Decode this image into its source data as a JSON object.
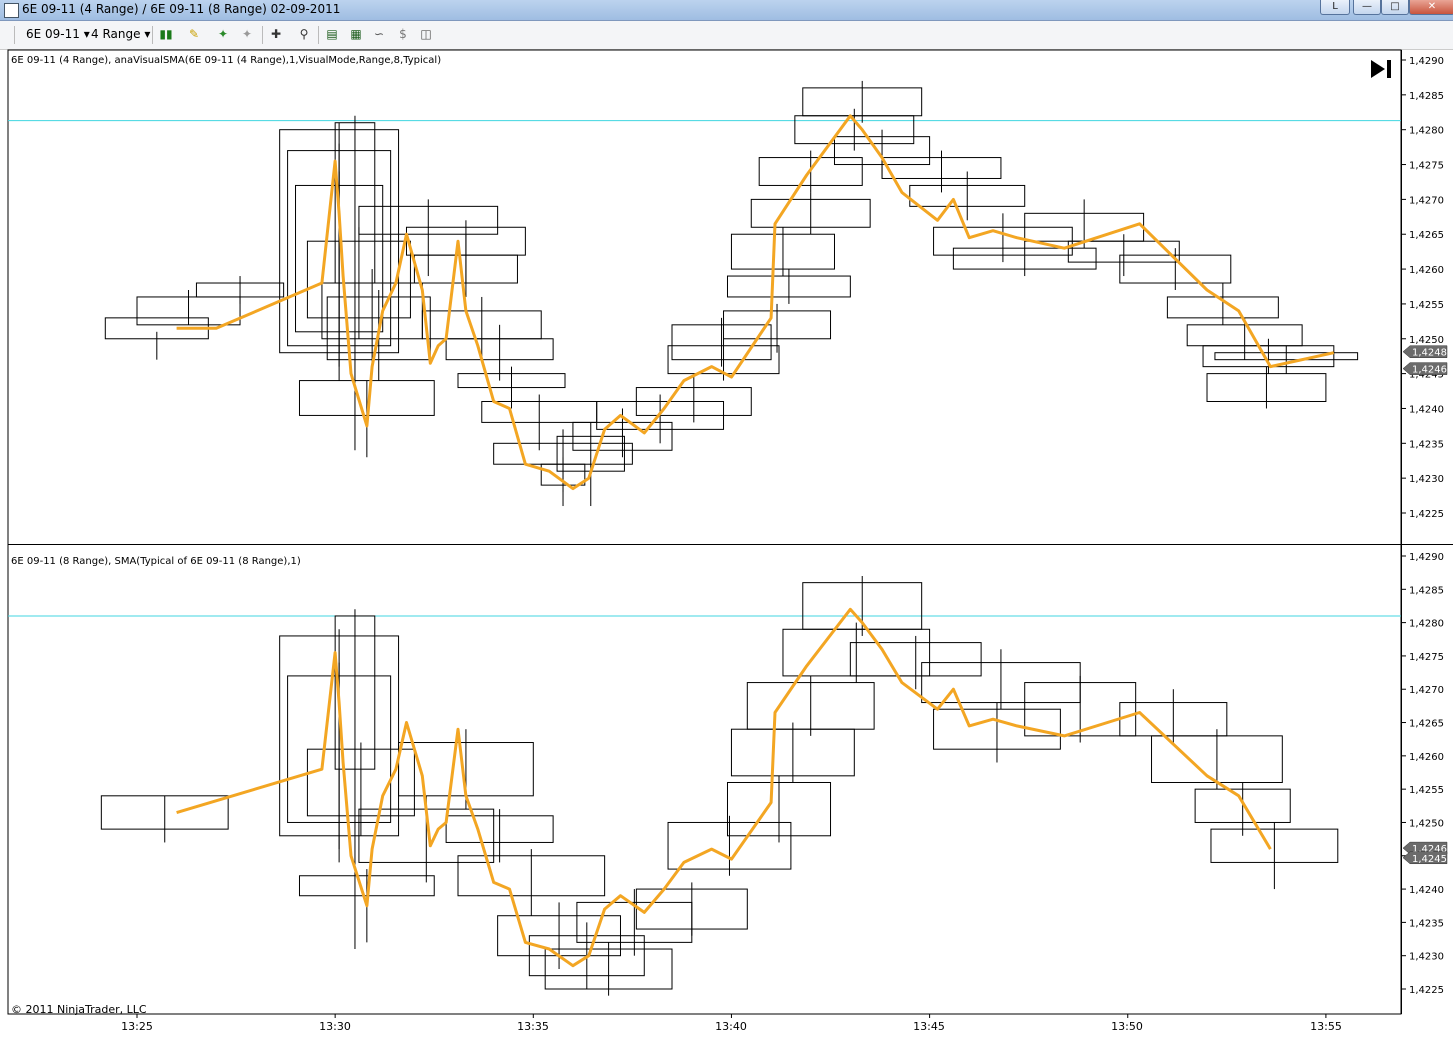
{
  "window": {
    "title": "6E 09-11 (4 Range) / 6E 09-11 (8 Range)  02-09-2011",
    "buttons": [
      "L",
      "—",
      "□",
      "✕"
    ]
  },
  "toolbar": {
    "instrument": "6E 09-11",
    "interval": "4 Range",
    "icons": [
      "bar-style-icon",
      "drawing-pencil-icon",
      "pin-icon",
      "pin-gray-icon",
      "crosshair-icon",
      "zoom-icon",
      "chart-properties-icon",
      "indicators-icon",
      "strategies-icon",
      "dollar-icon",
      "window-icon"
    ]
  },
  "colors": {
    "sma": "#f3a623",
    "hline": "#41d6e0",
    "bars": "#000000"
  },
  "copyright": "© 2011 NinjaTrader, LLC",
  "chart_data": [
    {
      "type": "candlestick",
      "title": "6E 09-11 (4 Range), anaVisualSMA(6E 09-11 (4 Range),1,VisualMode,Range,8,Typical)",
      "xlabel": "",
      "ylabel": "",
      "ylim": [
        1.4222,
        1.4292
      ],
      "yticks": [
        "1,4290",
        "1,4285",
        "1,4280",
        "1,4275",
        "1,4270",
        "1,4265",
        "1,4260",
        "1,4255",
        "1,4250",
        "1,4245",
        "1,4240",
        "1,4235",
        "1,4230",
        "1,4225"
      ],
      "hline": 1.42813,
      "price_markers": [
        "1,4248",
        "1,4246"
      ],
      "sma": {
        "x": [
          "13:26:00",
          "13:27:00",
          "13:29:40",
          "13:30:00",
          "13:30:06",
          "13:30:12",
          "13:30:24",
          "13:30:48",
          "13:30:56",
          "13:31:12",
          "13:31:32",
          "13:31:48",
          "13:32:12",
          "13:32:24",
          "13:32:36",
          "13:32:48",
          "13:33:06",
          "13:33:18",
          "13:33:36",
          "13:34:00",
          "13:34:24",
          "13:34:48",
          "13:35:24",
          "13:36:00",
          "13:36:24",
          "13:36:48",
          "13:37:12",
          "13:37:48",
          "13:38:18",
          "13:38:48",
          "13:39:30",
          "13:40:00",
          "13:41:00",
          "13:41:06",
          "13:41:54",
          "13:43:00",
          "13:43:18",
          "13:43:48",
          "13:44:18",
          "13:45:12",
          "13:45:36",
          "13:46:00",
          "13:46:36",
          "13:47:12",
          "13:48:24",
          "13:50:18",
          "13:52:00",
          "13:52:48",
          "13:53:36",
          "13:55:12"
        ],
        "y": [
          1.42515,
          1.42515,
          1.4258,
          1.42755,
          1.4268,
          1.4259,
          1.4245,
          1.42375,
          1.4246,
          1.4254,
          1.4258,
          1.4265,
          1.4257,
          1.42465,
          1.4249,
          1.425,
          1.4264,
          1.4254,
          1.4249,
          1.4241,
          1.424,
          1.4232,
          1.4231,
          1.42285,
          1.423,
          1.4237,
          1.4239,
          1.42365,
          1.424,
          1.4244,
          1.4246,
          1.42445,
          1.4253,
          1.42665,
          1.42735,
          1.4282,
          1.428,
          1.4276,
          1.4271,
          1.4267,
          1.427,
          1.42645,
          1.42655,
          1.42645,
          1.4263,
          1.42665,
          1.4257,
          1.4254,
          1.4246,
          1.4248
        ]
      },
      "bars": [
        {
          "x0": "13:24:12",
          "x1": "13:26:48",
          "o": 1.4253,
          "c": 1.425,
          "h": 1.4251,
          "l": 1.4247
        },
        {
          "x0": "13:25:00",
          "x1": "13:27:36",
          "o": 1.4256,
          "c": 1.4252,
          "h": 1.4257,
          "l": 1.4252
        },
        {
          "x0": "13:26:30",
          "x1": "13:28:42",
          "o": 1.4258,
          "c": 1.4256,
          "h": 1.4259,
          "l": 1.4255
        },
        {
          "x0": "13:28:36",
          "x1": "13:31:36",
          "o": 1.428,
          "c": 1.4248,
          "h": 1.4281,
          "l": 1.4244
        },
        {
          "x0": "13:28:48",
          "x1": "13:31:24",
          "o": 1.4277,
          "c": 1.4249,
          "h": 1.4278,
          "l": 1.4246
        },
        {
          "x0": "13:29:00",
          "x1": "13:31:12",
          "o": 1.4272,
          "c": 1.4251,
          "h": 1.4274,
          "l": 1.4248
        },
        {
          "x0": "13:29:18",
          "x1": "13:31:54",
          "o": 1.4264,
          "c": 1.4253,
          "h": 1.4266,
          "l": 1.425
        },
        {
          "x0": "13:29:40",
          "x1": "13:32:12",
          "o": 1.4258,
          "c": 1.425,
          "h": 1.426,
          "l": 1.4246
        },
        {
          "x0": "13:30:00",
          "x1": "13:31:00",
          "o": 1.4281,
          "c": 1.4258,
          "h": 1.4282,
          "l": 1.4234
        },
        {
          "x0": "13:29:48",
          "x1": "13:32:24",
          "o": 1.4256,
          "c": 1.4247,
          "h": 1.4257,
          "l": 1.4244
        },
        {
          "x0": "13:29:06",
          "x1": "13:32:30",
          "o": 1.4244,
          "c": 1.4239,
          "h": 1.4244,
          "l": 1.4233
        },
        {
          "x0": "13:30:36",
          "x1": "13:34:06",
          "o": 1.4269,
          "c": 1.4265,
          "h": 1.427,
          "l": 1.4259
        },
        {
          "x0": "13:31:48",
          "x1": "13:34:48",
          "o": 1.4266,
          "c": 1.4262,
          "h": 1.4267,
          "l": 1.4258
        },
        {
          "x0": "13:32:00",
          "x1": "13:34:36",
          "o": 1.4262,
          "c": 1.4258,
          "h": 1.4265,
          "l": 1.4256
        },
        {
          "x0": "13:32:12",
          "x1": "13:35:12",
          "o": 1.4254,
          "c": 1.425,
          "h": 1.4256,
          "l": 1.4247
        },
        {
          "x0": "13:32:48",
          "x1": "13:35:30",
          "o": 1.425,
          "c": 1.4247,
          "h": 1.4252,
          "l": 1.4244
        },
        {
          "x0": "13:33:06",
          "x1": "13:35:48",
          "o": 1.4245,
          "c": 1.4243,
          "h": 1.4246,
          "l": 1.424
        },
        {
          "x0": "13:33:42",
          "x1": "13:36:36",
          "o": 1.4241,
          "c": 1.4238,
          "h": 1.4242,
          "l": 1.4234
        },
        {
          "x0": "13:34:00",
          "x1": "13:37:30",
          "o": 1.4235,
          "c": 1.4232,
          "h": 1.4237,
          "l": 1.4228
        },
        {
          "x0": "13:35:12",
          "x1": "13:36:18",
          "o": 1.4232,
          "c": 1.4229,
          "h": 1.4233,
          "l": 1.4226
        },
        {
          "x0": "13:35:36",
          "x1": "13:37:18",
          "o": 1.4236,
          "c": 1.4231,
          "h": 1.4238,
          "l": 1.4226
        },
        {
          "x0": "13:36:00",
          "x1": "13:38:30",
          "o": 1.4238,
          "c": 1.4234,
          "h": 1.424,
          "l": 1.4233
        },
        {
          "x0": "13:36:36",
          "x1": "13:39:48",
          "o": 1.4241,
          "c": 1.4237,
          "h": 1.4242,
          "l": 1.4235
        },
        {
          "x0": "13:37:36",
          "x1": "13:40:30",
          "o": 1.4243,
          "c": 1.4239,
          "h": 1.4245,
          "l": 1.4238
        },
        {
          "x0": "13:38:24",
          "x1": "13:41:12",
          "o": 1.4249,
          "c": 1.4245,
          "h": 1.425,
          "l": 1.4244
        },
        {
          "x0": "13:38:30",
          "x1": "13:41:00",
          "o": 1.4252,
          "c": 1.4247,
          "h": 1.4253,
          "l": 1.4246
        },
        {
          "x0": "13:39:48",
          "x1": "13:42:30",
          "o": 1.4254,
          "c": 1.425,
          "h": 1.4255,
          "l": 1.4248
        },
        {
          "x0": "13:39:54",
          "x1": "13:43:00",
          "o": 1.4259,
          "c": 1.4256,
          "h": 1.426,
          "l": 1.4255
        },
        {
          "x0": "13:40:00",
          "x1": "13:42:36",
          "o": 1.4265,
          "c": 1.426,
          "h": 1.4266,
          "l": 1.4259
        },
        {
          "x0": "13:40:30",
          "x1": "13:43:30",
          "o": 1.427,
          "c": 1.4266,
          "h": 1.4271,
          "l": 1.4265
        },
        {
          "x0": "13:40:42",
          "x1": "13:43:18",
          "o": 1.4276,
          "c": 1.4272,
          "h": 1.4277,
          "l": 1.4271
        },
        {
          "x0": "13:41:36",
          "x1": "13:44:36",
          "o": 1.4282,
          "c": 1.4278,
          "h": 1.4283,
          "l": 1.4277
        },
        {
          "x0": "13:41:48",
          "x1": "13:44:48",
          "o": 1.4286,
          "c": 1.4282,
          "h": 1.4287,
          "l": 1.4281
        },
        {
          "x0": "13:42:36",
          "x1": "13:45:00",
          "o": 1.4279,
          "c": 1.4275,
          "h": 1.428,
          "l": 1.4273
        },
        {
          "x0": "13:43:48",
          "x1": "13:46:48",
          "o": 1.4276,
          "c": 1.4273,
          "h": 1.4277,
          "l": 1.4271
        },
        {
          "x0": "13:44:30",
          "x1": "13:47:24",
          "o": 1.4272,
          "c": 1.4269,
          "h": 1.4274,
          "l": 1.4267
        },
        {
          "x0": "13:45:06",
          "x1": "13:48:36",
          "o": 1.4266,
          "c": 1.4262,
          "h": 1.4268,
          "l": 1.4261
        },
        {
          "x0": "13:45:36",
          "x1": "13:49:12",
          "o": 1.4263,
          "c": 1.426,
          "h": 1.4264,
          "l": 1.4259
        },
        {
          "x0": "13:47:24",
          "x1": "13:50:24",
          "o": 1.4268,
          "c": 1.4264,
          "h": 1.427,
          "l": 1.4263
        },
        {
          "x0": "13:48:30",
          "x1": "13:51:18",
          "o": 1.4264,
          "c": 1.4261,
          "h": 1.4265,
          "l": 1.4259
        },
        {
          "x0": "13:49:48",
          "x1": "13:52:36",
          "o": 1.4262,
          "c": 1.4258,
          "h": 1.4263,
          "l": 1.4257
        },
        {
          "x0": "13:51:00",
          "x1": "13:53:48",
          "o": 1.4256,
          "c": 1.4253,
          "h": 1.4258,
          "l": 1.4252
        },
        {
          "x0": "13:51:30",
          "x1": "13:54:24",
          "o": 1.4252,
          "c": 1.4249,
          "h": 1.4253,
          "l": 1.4247
        },
        {
          "x0": "13:51:54",
          "x1": "13:55:12",
          "o": 1.4249,
          "c": 1.4246,
          "h": 1.425,
          "l": 1.4245
        },
        {
          "x0": "13:52:12",
          "x1": "13:55:48",
          "o": 1.4248,
          "c": 1.4247,
          "h": 1.4249,
          "l": 1.4245
        },
        {
          "x0": "13:52:00",
          "x1": "13:55:00",
          "o": 1.4245,
          "c": 1.4241,
          "h": 1.4246,
          "l": 1.424
        }
      ]
    },
    {
      "type": "candlestick",
      "title": "6E 09-11 (8 Range), SMA(Typical of 6E 09-11 (8 Range),1)",
      "xlabel": "",
      "ylabel": "",
      "ylim": [
        1.4222,
        1.4292
      ],
      "yticks": [
        "1,4290",
        "1,4285",
        "1,4280",
        "1,4275",
        "1,4270",
        "1,4265",
        "1,4260",
        "1,4255",
        "1,4250",
        "1,4245",
        "1,4240",
        "1,4235",
        "1,4230",
        "1,4225"
      ],
      "hline": 1.4281,
      "price_markers": [
        "1,4246",
        "1,4245"
      ],
      "xticks": [
        "13:25",
        "13:30",
        "13:35",
        "13:40",
        "13:45",
        "13:50",
        "13:55"
      ],
      "sma": {
        "x": [
          "13:26:00",
          "13:29:40",
          "13:30:00",
          "13:30:06",
          "13:30:12",
          "13:30:24",
          "13:30:48",
          "13:30:56",
          "13:31:12",
          "13:31:32",
          "13:31:48",
          "13:32:12",
          "13:32:24",
          "13:32:36",
          "13:32:48",
          "13:33:06",
          "13:33:18",
          "13:33:36",
          "13:34:00",
          "13:34:24",
          "13:34:48",
          "13:35:24",
          "13:36:00",
          "13:36:24",
          "13:36:48",
          "13:37:12",
          "13:37:48",
          "13:38:18",
          "13:38:48",
          "13:39:30",
          "13:40:00",
          "13:41:00",
          "13:41:06",
          "13:41:54",
          "13:43:00",
          "13:43:18",
          "13:43:48",
          "13:44:18",
          "13:45:12",
          "13:45:36",
          "13:46:00",
          "13:46:36",
          "13:47:12",
          "13:48:24",
          "13:50:18",
          "13:52:00",
          "13:52:48",
          "13:53:36"
        ],
        "y": [
          1.42515,
          1.4258,
          1.42755,
          1.4268,
          1.4259,
          1.4245,
          1.42375,
          1.4246,
          1.4254,
          1.4258,
          1.4265,
          1.4257,
          1.42465,
          1.4249,
          1.425,
          1.4264,
          1.4254,
          1.4249,
          1.4241,
          1.424,
          1.4232,
          1.4231,
          1.42285,
          1.423,
          1.4237,
          1.4239,
          1.42365,
          1.424,
          1.4244,
          1.4246,
          1.42445,
          1.4253,
          1.42665,
          1.42735,
          1.4282,
          1.428,
          1.4276,
          1.4271,
          1.4267,
          1.427,
          1.42645,
          1.42655,
          1.42645,
          1.4263,
          1.42665,
          1.4257,
          1.4254,
          1.4246
        ]
      },
      "bars": [
        {
          "x0": "13:24:06",
          "x1": "13:27:18",
          "o": 1.4254,
          "c": 1.4249,
          "h": 1.4254,
          "l": 1.4247
        },
        {
          "x0": "13:28:36",
          "x1": "13:31:36",
          "o": 1.4278,
          "c": 1.4248,
          "h": 1.4279,
          "l": 1.4244
        },
        {
          "x0": "13:28:48",
          "x1": "13:31:24",
          "o": 1.4272,
          "c": 1.425,
          "h": 1.4274,
          "l": 1.4246
        },
        {
          "x0": "13:29:18",
          "x1": "13:32:00",
          "o": 1.4261,
          "c": 1.4251,
          "h": 1.4262,
          "l": 1.4248
        },
        {
          "x0": "13:30:00",
          "x1": "13:31:00",
          "o": 1.4281,
          "c": 1.4258,
          "h": 1.4282,
          "l": 1.4231
        },
        {
          "x0": "13:29:06",
          "x1": "13:32:30",
          "o": 1.4242,
          "c": 1.4239,
          "h": 1.4243,
          "l": 1.4232
        },
        {
          "x0": "13:30:36",
          "x1": "13:34:00",
          "o": 1.4252,
          "c": 1.4244,
          "h": 1.4254,
          "l": 1.4241
        },
        {
          "x0": "13:31:36",
          "x1": "13:35:00",
          "o": 1.4262,
          "c": 1.4254,
          "h": 1.4264,
          "l": 1.4252
        },
        {
          "x0": "13:32:48",
          "x1": "13:35:30",
          "o": 1.4251,
          "c": 1.4247,
          "h": 1.4252,
          "l": 1.4244
        },
        {
          "x0": "13:33:06",
          "x1": "13:36:48",
          "o": 1.4245,
          "c": 1.4239,
          "h": 1.4246,
          "l": 1.4236
        },
        {
          "x0": "13:34:06",
          "x1": "13:37:12",
          "o": 1.4236,
          "c": 1.423,
          "h": 1.4238,
          "l": 1.4228
        },
        {
          "x0": "13:34:54",
          "x1": "13:37:48",
          "o": 1.4233,
          "c": 1.4227,
          "h": 1.4235,
          "l": 1.4225
        },
        {
          "x0": "13:35:18",
          "x1": "13:38:30",
          "o": 1.4231,
          "c": 1.4225,
          "h": 1.4232,
          "l": 1.4224
        },
        {
          "x0": "13:36:06",
          "x1": "13:39:00",
          "o": 1.4238,
          "c": 1.4232,
          "h": 1.424,
          "l": 1.423
        },
        {
          "x0": "13:37:36",
          "x1": "13:40:24",
          "o": 1.424,
          "c": 1.4234,
          "h": 1.4241,
          "l": 1.4233
        },
        {
          "x0": "13:38:24",
          "x1": "13:41:30",
          "o": 1.425,
          "c": 1.4243,
          "h": 1.4251,
          "l": 1.4242
        },
        {
          "x0": "13:39:54",
          "x1": "13:42:30",
          "o": 1.4256,
          "c": 1.4248,
          "h": 1.4257,
          "l": 1.4247
        },
        {
          "x0": "13:40:00",
          "x1": "13:43:06",
          "o": 1.4264,
          "c": 1.4257,
          "h": 1.4265,
          "l": 1.4256
        },
        {
          "x0": "13:40:24",
          "x1": "13:43:36",
          "o": 1.4271,
          "c": 1.4264,
          "h": 1.4272,
          "l": 1.4263
        },
        {
          "x0": "13:41:18",
          "x1": "13:45:00",
          "o": 1.4279,
          "c": 1.4272,
          "h": 1.428,
          "l": 1.4271
        },
        {
          "x0": "13:41:48",
          "x1": "13:44:48",
          "o": 1.4286,
          "c": 1.4279,
          "h": 1.4287,
          "l": 1.4278
        },
        {
          "x0": "13:43:00",
          "x1": "13:46:18",
          "o": 1.4277,
          "c": 1.4272,
          "h": 1.4278,
          "l": 1.427
        },
        {
          "x0": "13:44:48",
          "x1": "13:48:48",
          "o": 1.4274,
          "c": 1.4268,
          "h": 1.4276,
          "l": 1.4267
        },
        {
          "x0": "13:45:06",
          "x1": "13:48:18",
          "o": 1.4267,
          "c": 1.4261,
          "h": 1.4268,
          "l": 1.4259
        },
        {
          "x0": "13:47:24",
          "x1": "13:50:12",
          "o": 1.4271,
          "c": 1.4263,
          "h": 1.4272,
          "l": 1.4262
        },
        {
          "x0": "13:49:48",
          "x1": "13:52:30",
          "o": 1.4268,
          "c": 1.4263,
          "h": 1.427,
          "l": 1.4262
        },
        {
          "x0": "13:50:36",
          "x1": "13:53:54",
          "o": 1.4263,
          "c": 1.4256,
          "h": 1.4264,
          "l": 1.4255
        },
        {
          "x0": "13:51:42",
          "x1": "13:54:06",
          "o": 1.4255,
          "c": 1.425,
          "h": 1.4256,
          "l": 1.4248
        },
        {
          "x0": "13:52:06",
          "x1": "13:55:18",
          "o": 1.4249,
          "c": 1.4244,
          "h": 1.425,
          "l": 1.424
        }
      ]
    }
  ]
}
